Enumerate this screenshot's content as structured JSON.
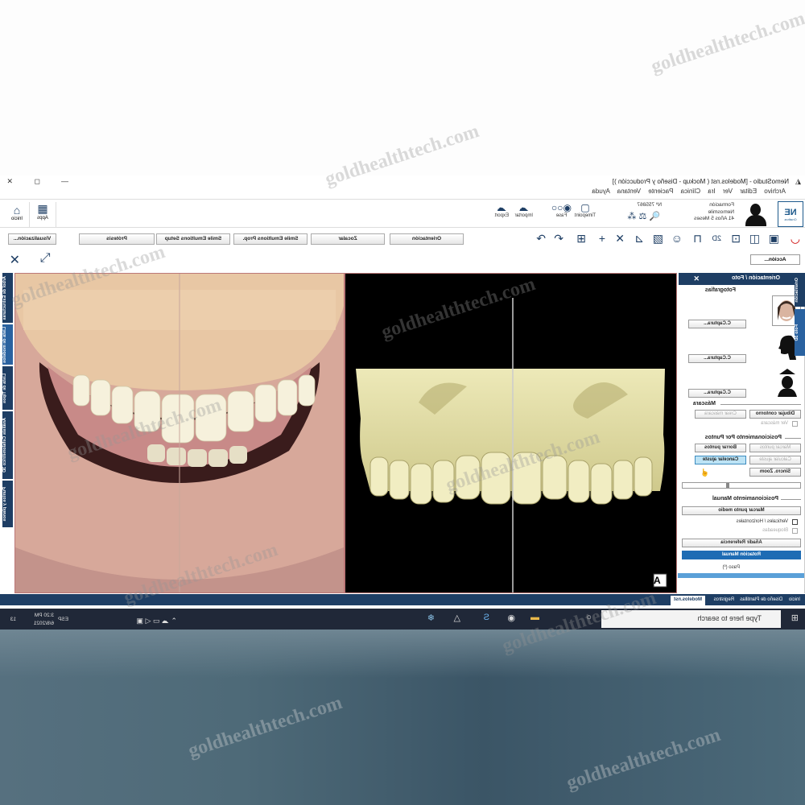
{
  "window": {
    "title": "NemoStudio - [Modelos.nst ( Mockup - Diseño y Producción )]",
    "controls": [
      "—",
      "◻",
      "✕"
    ]
  },
  "menu": [
    "Archivo",
    "Editar",
    "Ver",
    "Ira",
    "Clínica",
    "Paciente",
    "Ventana",
    "Ayuda"
  ],
  "ribbon": {
    "badge": "NE",
    "badge_sub": "Gnathos",
    "patient_lines": [
      "Formación",
      "Nemosmile",
      "41 Años 5 Meses"
    ],
    "patient_number": "Nº 755867",
    "buttons": [
      "Timepoint",
      "Fase",
      "Importar",
      "Export",
      "Apps",
      "Inicio"
    ]
  },
  "toolbar": {
    "buttons": [
      "Visualización...",
      "Prótesis",
      "Smile Emultions Setup",
      "Smile Emultions Prop.",
      "Zocalar",
      "Orientación"
    ],
    "view": "2D"
  },
  "action_button": "Acción...",
  "panel": {
    "title": "Orientación / Foto",
    "sections": {
      "photos": "Fotografías",
      "mask": "Máscara",
      "points": "Posicionamiento Por Puntos",
      "manual": "Posicionamiento Manual"
    },
    "capture": "C.Captura...",
    "draw_contour": "Dibujar contorno",
    "create_mask": "Crear máscara",
    "view_mask": "Ver máscara",
    "mark_points": "Marcar puntos",
    "delete_points": "Borrar puntos",
    "calc_fit": "Calcular ajuste",
    "cancel_fit": "Cancelar ajuste",
    "sync_zoom": "Sincro. Zoom",
    "mark_mid": "Marcar punto medio",
    "vert_horiz": "Verticales / Horizontales",
    "locked": "Bloqueadas",
    "add_ref": "Añadir Referencia",
    "manual_rot": "Rotación Manual",
    "step": "Paso (º)"
  },
  "right_vtabs": [
    "Orientación",
    "Foto 3D"
  ],
  "left_vtabs": [
    "Árbol de Estructuras",
    "Lista de modelos",
    "Lista de Tipos",
    "Análisis Cefalométrico 3D",
    "Puntos y planos"
  ],
  "bottom_tabs": [
    "Inicio",
    "Diseño de Plantillas",
    "Registros",
    "Modelos.nst"
  ],
  "viewport_label": "A",
  "taskbar": {
    "search": "Type here to search",
    "lang": "ESP",
    "time": "3:20 PM",
    "date": "6/8/2021",
    "notif": "13"
  },
  "watermark": "goldhealthtech.com"
}
